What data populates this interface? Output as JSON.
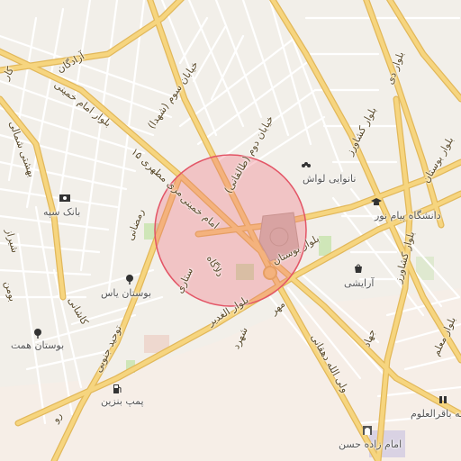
{
  "map": {
    "circle_fill": "#f06a78",
    "circle_stroke": "#e35566",
    "major_road_color": "#f6d57f",
    "major_road_casing": "#e2b85a",
    "street_labels": [
      {
        "text": "آزادگان"
      },
      {
        "text": "کار"
      },
      {
        "text": "بلوار امام خمینی"
      },
      {
        "text": "خیابان سوم (شهدا)"
      },
      {
        "text": "خیابان دوم (طالقانی)"
      },
      {
        "text": "بلوار کشاورز"
      },
      {
        "text": "بلوار بوستان"
      },
      {
        "text": "بلوار دی"
      },
      {
        "text": "بهشتی شمالی"
      },
      {
        "text": "۱۵ مری مطهری"
      },
      {
        "text": "رمضانی"
      },
      {
        "text": "امام خمینی"
      },
      {
        "text": "بلوار بوستان"
      },
      {
        "text": "دلاگاه"
      },
      {
        "text": "ستاری"
      },
      {
        "text": "بلوار الغدیر"
      },
      {
        "text": "کاشانی"
      },
      {
        "text": "توحید جنوبی"
      },
      {
        "text": "مهر"
      },
      {
        "text": "شهرد"
      },
      {
        "text": "ولی الله دهقانی"
      },
      {
        "text": "بلوار کشاورز"
      },
      {
        "text": "بلوار معلم"
      },
      {
        "text": "جهاد"
      },
      {
        "text": "رو"
      },
      {
        "text": "شیراز"
      },
      {
        "text": "بومن"
      }
    ],
    "pois": [
      {
        "text": "نانوایی لواش",
        "icon": "bakery-icon"
      },
      {
        "text": "دانشگاه پیام نور",
        "icon": "university-icon"
      },
      {
        "text": "بانک سپه",
        "icon": "bank-icon"
      },
      {
        "text": "آرایشی",
        "icon": "cosmetics-shop-icon"
      },
      {
        "text": "بوستان یاس",
        "icon": "park-icon"
      },
      {
        "text": "بوستان همت",
        "icon": "park-icon"
      },
      {
        "text": "پمپ بنزین",
        "icon": "fuel-station-icon"
      },
      {
        "text": "مدرسه باقرالعلوم",
        "icon": "school-icon"
      },
      {
        "text": "امام زاده حسن",
        "icon": "shrine-icon"
      }
    ]
  }
}
